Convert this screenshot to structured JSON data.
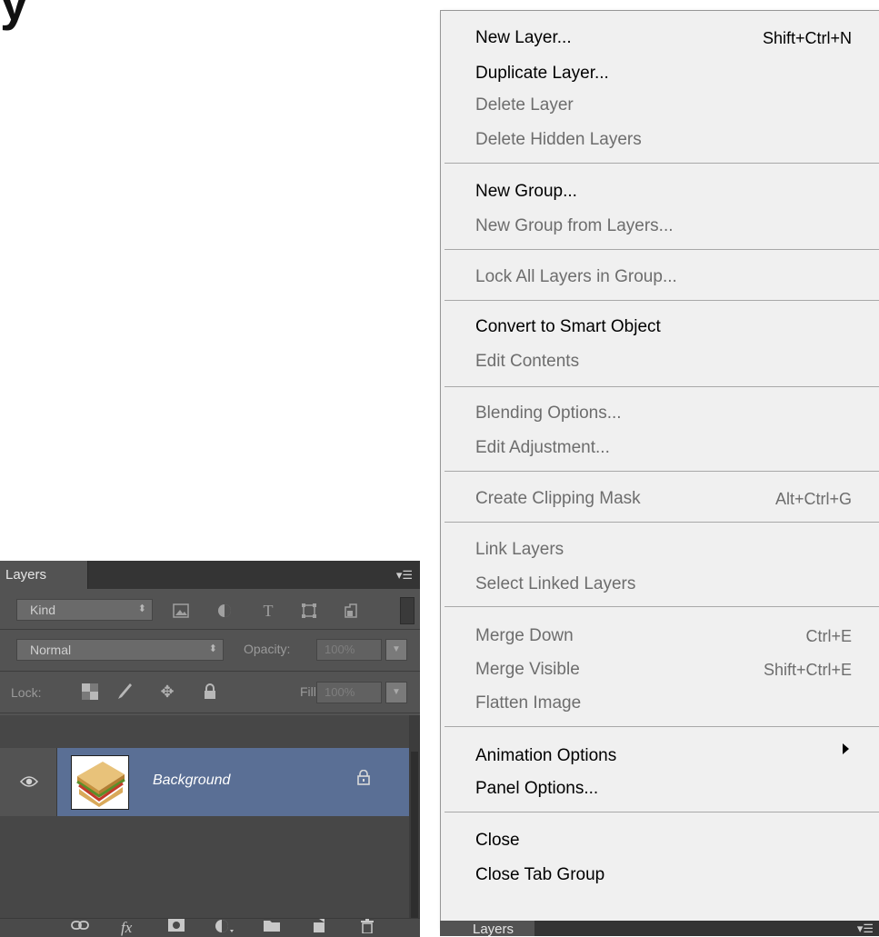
{
  "heading_fragment": "y",
  "layers_panel": {
    "tab_title": "Layers",
    "menu_icon": "panel-menu-icon",
    "filter_kind": "Kind",
    "blend_mode": "Normal",
    "opacity_label": "Opacity:",
    "opacity_value": "100%",
    "lock_label": "Lock:",
    "fill_label": "Fill:",
    "fill_value": "100%",
    "layers": [
      {
        "name": "Background",
        "visible": true,
        "locked": true
      }
    ],
    "footer_icons": [
      "link-icon",
      "fx-icon",
      "mask-icon",
      "adjustment-icon",
      "group-icon",
      "new-layer-icon",
      "trash-icon"
    ]
  },
  "menu": {
    "items": [
      {
        "label": "New Layer...",
        "shortcut": "Shift+Ctrl+N",
        "enabled": true
      },
      {
        "label": "Duplicate Layer...",
        "shortcut": "",
        "enabled": true
      },
      {
        "label": "Delete Layer",
        "shortcut": "",
        "enabled": false
      },
      {
        "label": "Delete Hidden Layers",
        "shortcut": "",
        "enabled": false
      },
      {
        "label": "New Group...",
        "shortcut": "",
        "enabled": true
      },
      {
        "label": "New Group from Layers...",
        "shortcut": "",
        "enabled": false
      },
      {
        "label": "Lock All Layers in Group...",
        "shortcut": "",
        "enabled": false
      },
      {
        "label": "Convert to Smart Object",
        "shortcut": "",
        "enabled": true
      },
      {
        "label": "Edit Contents",
        "shortcut": "",
        "enabled": false
      },
      {
        "label": "Blending Options...",
        "shortcut": "",
        "enabled": false
      },
      {
        "label": "Edit Adjustment...",
        "shortcut": "",
        "enabled": false
      },
      {
        "label": "Create Clipping Mask",
        "shortcut": "Alt+Ctrl+G",
        "enabled": false
      },
      {
        "label": "Link Layers",
        "shortcut": "",
        "enabled": false
      },
      {
        "label": "Select Linked Layers",
        "shortcut": "",
        "enabled": false
      },
      {
        "label": "Merge Down",
        "shortcut": "Ctrl+E",
        "enabled": false
      },
      {
        "label": "Merge Visible",
        "shortcut": "Shift+Ctrl+E",
        "enabled": false
      },
      {
        "label": "Flatten Image",
        "shortcut": "",
        "enabled": false
      },
      {
        "label": "Animation Options",
        "shortcut": "",
        "enabled": true,
        "submenu": true
      },
      {
        "label": "Panel Options...",
        "shortcut": "",
        "enabled": true
      },
      {
        "label": "Close",
        "shortcut": "",
        "enabled": true
      },
      {
        "label": "Close Tab Group",
        "shortcut": "",
        "enabled": true
      }
    ]
  },
  "layers_panel_2": {
    "tab_title": "Layers"
  }
}
